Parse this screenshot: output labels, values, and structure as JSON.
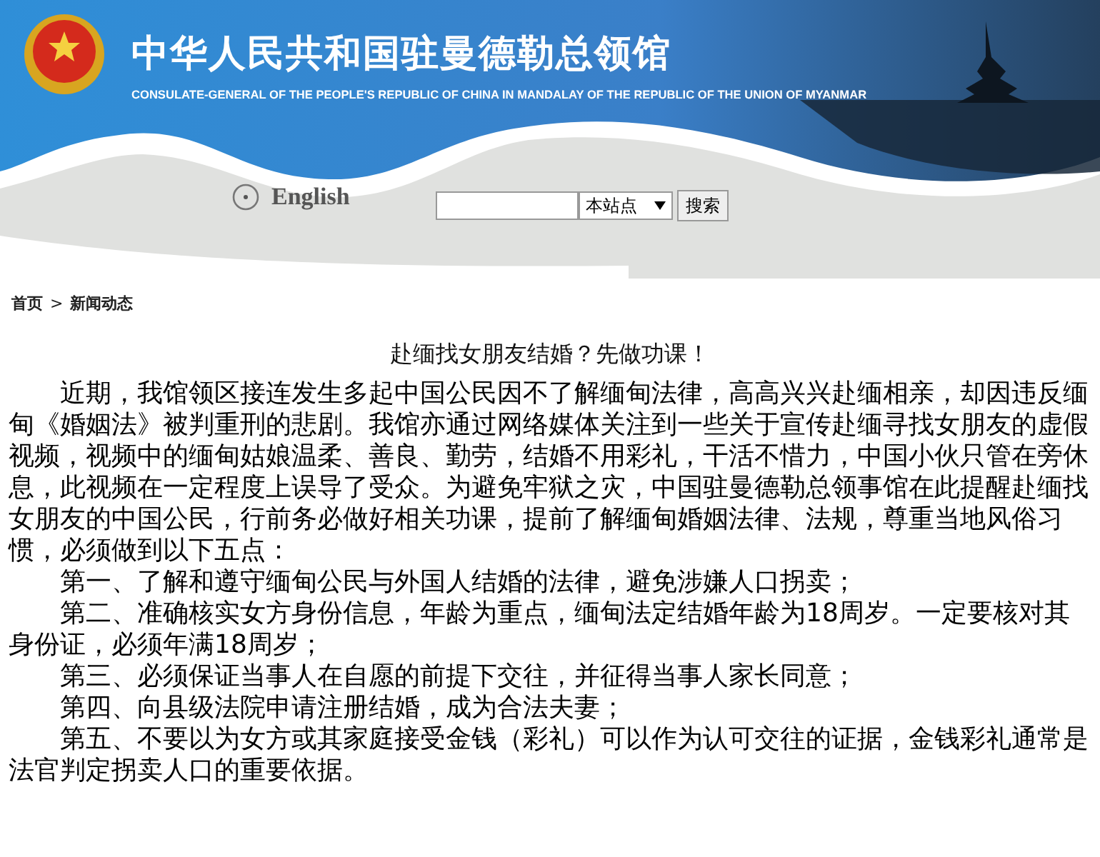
{
  "header": {
    "title": "中华人民共和国驻曼德勒总领馆",
    "subtitle": "CONSULATE-GENERAL OF THE PEOPLE'S REPUBLIC OF CHINA IN MANDALAY OF THE REPUBLIC OF THE UNION OF MYANMAR"
  },
  "language_link": "English",
  "search": {
    "scope": "本站点",
    "button": "搜索"
  },
  "breadcrumb": {
    "items": [
      "首页",
      "新闻动态"
    ],
    "separator": ">"
  },
  "article": {
    "title": "赴缅找女朋友结婚？先做功课！",
    "paragraphs": [
      "近期，我馆领区接连发生多起中国公民因不了解缅甸法律，高高兴兴赴缅相亲，却因违反缅甸《婚姻法》被判重刑的悲剧。我馆亦通过网络媒体关注到一些关于宣传赴缅寻找女朋友的虚假视频，视频中的缅甸姑娘温柔、善良、勤劳，结婚不用彩礼，干活不惜力，中国小伙只管在旁休息，此视频在一定程度上误导了受众。为避免牢狱之灾，中国驻曼德勒总领事馆在此提醒赴缅找女朋友的中国公民，行前务必做好相关功课，提前了解缅甸婚姻法律、法规，尊重当地风俗习惯，必须做到以下五点：",
      "第一、了解和遵守缅甸公民与外国人结婚的法律，避免涉嫌人口拐卖；",
      "第二、准确核实女方身份信息，年龄为重点，缅甸法定结婚年龄为18周岁。一定要核对其身份证，必须年满18周岁；",
      "第三、必须保证当事人在自愿的前提下交往，并征得当事人家长同意；",
      "第四、向县级法院申请注册结婚，成为合法夫妻；",
      "第五、不要以为女方或其家庭接受金钱（彩礼）可以作为认可交往的证据，金钱彩礼通常是法官判定拐卖人口的重要依据。"
    ]
  }
}
